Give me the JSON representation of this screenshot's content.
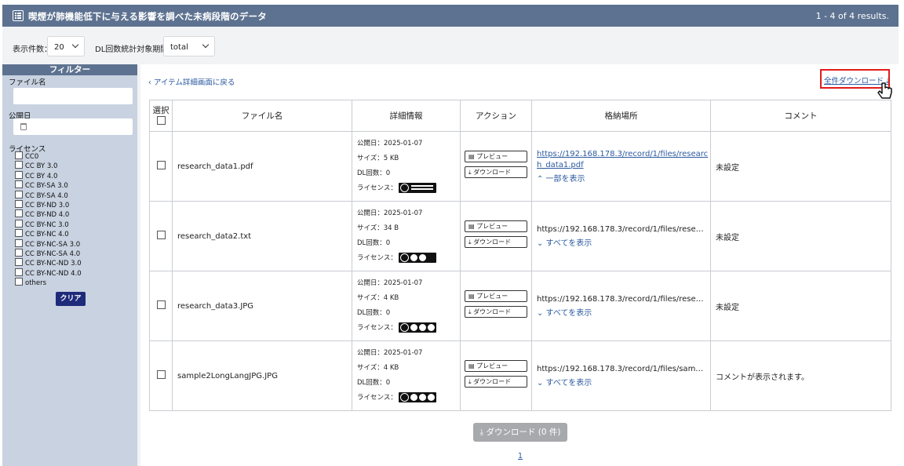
{
  "header": {
    "title": "喫煙が肺機能低下に与える影響を調べた未病段階のデータ",
    "results": "1 - 4 of 4 results."
  },
  "controls": {
    "per_page_label": "表示件数：",
    "per_page_value": "20",
    "dl_period_label": "DL回数統計対象期間：",
    "dl_period_value": "total"
  },
  "sidebar": {
    "filter_title": "フィルター",
    "file_name_label": "ファイル名",
    "pub_date_label": "公開日",
    "license_label": "ライセンス",
    "licenses": [
      "CC0",
      "CC BY 3.0",
      "CC BY 4.0",
      "CC BY-SA 3.0",
      "CC BY-SA 4.0",
      "CC BY-ND 3.0",
      "CC BY-ND 4.0",
      "CC BY-NC 3.0",
      "CC BY-NC 4.0",
      "CC BY-NC-SA 3.0",
      "CC BY-NC-SA 4.0",
      "CC BY-NC-ND 3.0",
      "CC BY-NC-ND 4.0",
      "others"
    ],
    "clear_label": "クリア"
  },
  "main": {
    "back_label": "‹ アイテム詳細画面に戻る",
    "download_all_label": "全件ダウンロード ⤓",
    "columns": [
      "選択",
      "ファイル名",
      "詳細情報",
      "アクション",
      "格納場所",
      "コメント"
    ],
    "preview_label": "プレビュー",
    "download_label": "ダウンロード",
    "rows": [
      {
        "file": "research_data1.pdf",
        "date": "公開日：2025-01-07",
        "size": "サイズ：5 KB",
        "dl": "DL回数：0",
        "license": "ライセンス：",
        "url": "https://192.168.178.3/record/1/files/research_data1.pdf",
        "more": "⌃ 一部を表示",
        "comment": "未設定"
      },
      {
        "file": "research_data2.txt",
        "date": "公開日：2025-01-07",
        "size": "サイズ：34 B",
        "dl": "DL回数：0",
        "license": "ライセンス：",
        "url": "https://192.168.178.3/record/1/files/rese…",
        "more": "⌄ すべてを表示",
        "comment": "未設定"
      },
      {
        "file": "research_data3.JPG",
        "date": "公開日：2025-01-07",
        "size": "サイズ：4 KB",
        "dl": "DL回数：0",
        "license": "ライセンス：",
        "url": "https://192.168.178.3/record/1/files/rese…",
        "more": "⌄ すべてを表示",
        "comment": "未設定"
      },
      {
        "file": "sample2LongLangJPG.JPG",
        "date": "公開日：2025-01-07",
        "size": "サイズ：4 KB",
        "dl": "DL回数：0",
        "license": "ライセンス：",
        "url": "https://192.168.178.3/record/1/files/sam…",
        "more": "⌄ すべてを表示",
        "comment": "コメントが表示されます。"
      }
    ],
    "download_selected_label": "⤓ ダウンロード (0 件)",
    "page_number": "1"
  }
}
